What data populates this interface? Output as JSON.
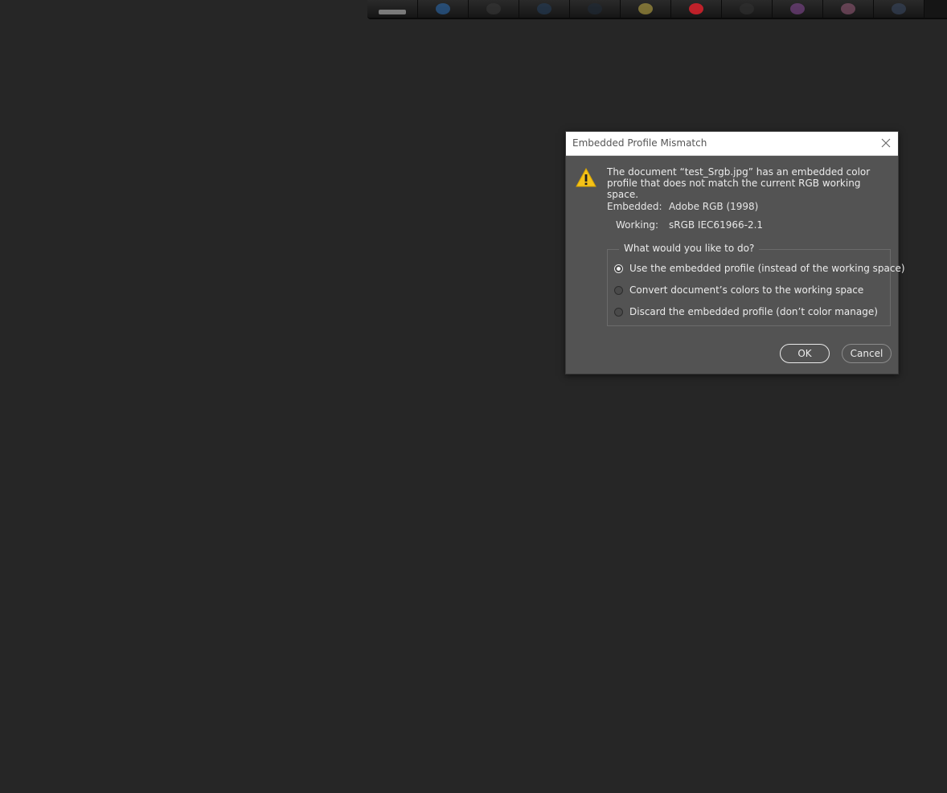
{
  "dialog": {
    "title": "Embedded Profile Mismatch",
    "message": "The document “test_Srgb.jpg” has an embedded color profile that does not match the current RGB working space.",
    "embedded_label": "Embedded:",
    "embedded_value": "Adobe RGB (1998)",
    "working_label": "Working:",
    "working_value": "sRGB IEC61966-2.1",
    "group_legend": "What would you like to do?",
    "options": [
      {
        "label": "Use the embedded profile (instead of the working space)",
        "selected": true
      },
      {
        "label": "Convert document’s colors to the working space",
        "selected": false
      },
      {
        "label": "Discard the embedded profile (don’t color manage)",
        "selected": false
      }
    ],
    "ok_label": "OK",
    "cancel_label": "Cancel"
  },
  "icons": {
    "warning": "warning-icon",
    "close": "close-icon"
  },
  "colors": {
    "dialog_bg": "#535353",
    "desktop_bg": "#262626",
    "warning": "#f5c218"
  }
}
